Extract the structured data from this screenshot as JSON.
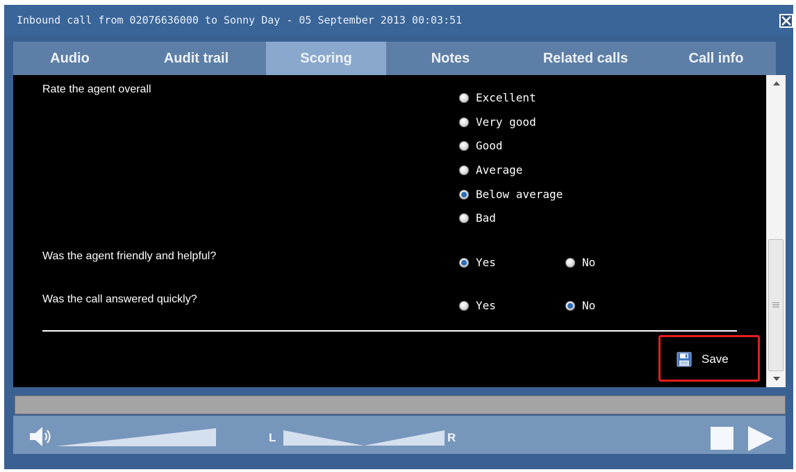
{
  "window": {
    "title": "Inbound call from 02076636000 to Sonny Day - 05 September 2013 00:03:51",
    "close_icon": "close-icon"
  },
  "tabs": [
    {
      "label": "Audio",
      "active": false
    },
    {
      "label": "Audit trail",
      "active": false
    },
    {
      "label": "Scoring",
      "active": true
    },
    {
      "label": "Notes",
      "active": false
    },
    {
      "label": "Related calls",
      "active": false
    },
    {
      "label": "Call info",
      "active": false
    }
  ],
  "scoring": {
    "questions": [
      {
        "label": "Rate the agent overall",
        "options": [
          "Excellent",
          "Very good",
          "Good",
          "Average",
          "Below average",
          "Bad"
        ],
        "selected": "Below average"
      },
      {
        "label": "Was the agent friendly and helpful?",
        "options": [
          "Yes",
          "No"
        ],
        "selected": "Yes"
      },
      {
        "label": "Was the call answered quickly?",
        "options": [
          "Yes",
          "No"
        ],
        "selected": "No"
      }
    ],
    "save_label": "Save",
    "save_icon": "floppy-disk-icon"
  },
  "player": {
    "progress": 0.0,
    "volume_icon": "speaker-icon",
    "balance_left_label": "L",
    "balance_right_label": "R",
    "stop_icon": "stop-icon",
    "play_icon": "play-icon"
  },
  "colors": {
    "window_frame": "#3b6192",
    "tab_active": "#8aa8cd",
    "content_bg": "#000000",
    "highlight": "#e81c1c"
  }
}
